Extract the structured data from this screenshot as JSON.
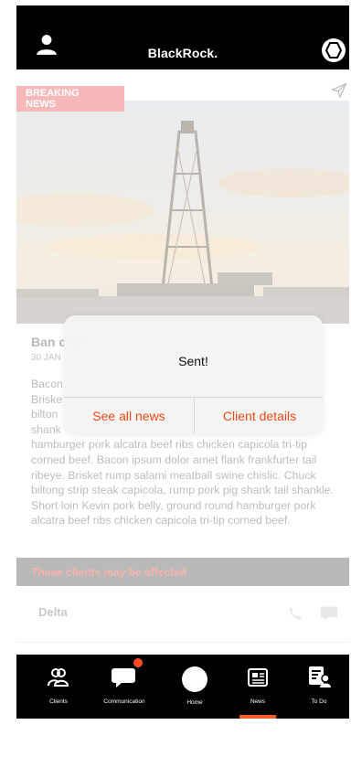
{
  "header": {
    "brand": "BlackRock."
  },
  "article": {
    "badge": "BREAKING\nNEWS",
    "title_visible": "Ban c                                                                op",
    "date_visible": "30 JAN",
    "body_visible_lines": [
      "Bacon",
      "Briske",
      "bilton",
      "shank"
    ],
    "body": "hamburger pork alcatra beef ribs chicken capicola tri-tip corned beef.  Bacon ipsum dolor amet flank frankfurter tail ribeye. Brisket rump salami meatball swine chislic. Chuck biltong strip steak capicola, rump pork pig shank tail shankle. Short loin Kevin pork belly, ground round hamburger pork alcatra beef ribs chicken capicola tri-tip corned beef."
  },
  "clients_section": {
    "label": "These clients may be affected",
    "clients": [
      {
        "name": "Delta"
      }
    ]
  },
  "bottom_nav": {
    "items": [
      {
        "label": "Clients",
        "icon": "clients-icon"
      },
      {
        "label": "Communication",
        "icon": "communication-icon"
      },
      {
        "label": "Home",
        "icon": "home-icon"
      },
      {
        "label": "News",
        "icon": "news-icon",
        "active": true
      },
      {
        "label": "To Do",
        "icon": "todo-icon"
      }
    ]
  },
  "dialog": {
    "title": "Sent!",
    "buttons": [
      {
        "label": "See all news"
      },
      {
        "label": "Client details"
      }
    ]
  },
  "colors": {
    "accent": "#F24A14",
    "header_bg": "#000000",
    "badge_bg": "#F6B8B8",
    "clients_bar_bg": "#B9B9B9"
  }
}
